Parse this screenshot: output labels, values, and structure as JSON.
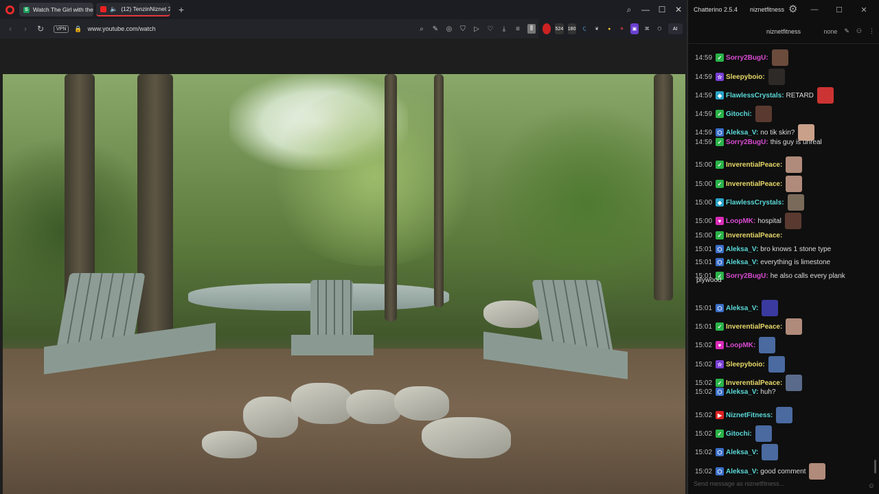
{
  "browser": {
    "tabs": [
      {
        "label": "Watch The Girl with the D",
        "favicon": "S",
        "active": true
      },
      {
        "label": "(12) TenzinNiznet 202",
        "favicon": "yt",
        "active": false
      }
    ],
    "new_tab": "+",
    "controls": {
      "search": "⌕",
      "minimize": "—",
      "maximize": "☐",
      "close": "✕"
    },
    "address": {
      "vpn": "VPN",
      "url": "www.youtube.com/watch"
    },
    "ext_labels": {
      "count_a": "524",
      "count_b": "180",
      "ai": "AI"
    }
  },
  "chat": {
    "app_title": "Chatterino 2.5.4",
    "user": "niznetfitness",
    "channel": "niznetfitness",
    "mode": "none",
    "input_placeholder": "Send message as niznetfitness...",
    "messages": [
      {
        "time": "14:59",
        "badge": "green",
        "name": "Sorry2BugU:",
        "color": "#d94bd2",
        "text": "",
        "emote": "#6b4b3b"
      },
      {
        "time": "14:59",
        "badge": "purple",
        "name": "Sleepyboio:",
        "color": "#e8d96a",
        "text": "",
        "emote": "#2e2a28"
      },
      {
        "time": "14:59",
        "badge": "cyan",
        "name": "FlawlessCrystals:",
        "color": "#5ad8d8",
        "text": "RETARD",
        "emote": "#c33"
      },
      {
        "time": "14:59",
        "badge": "green",
        "name": "Gitochi:",
        "color": "#5ad8d8",
        "text": "",
        "emote": "#5a3a30"
      },
      {
        "time": "14:59",
        "badge": "blue",
        "name": "Aleksa_V:",
        "color": "#5ad8d8",
        "text": "no tik skin?",
        "emote": "#c9a08a"
      },
      {
        "time": "14:59",
        "badge": "green",
        "name": "Sorry2BugU:",
        "color": "#d94bd2",
        "text": "this guy is unreal",
        "emote": ""
      },
      {
        "time": "15:00",
        "badge": "green",
        "name": "InverentialPeace:",
        "color": "#e8d96a",
        "text": "",
        "emote": "#b08a7a"
      },
      {
        "time": "15:00",
        "badge": "green",
        "name": "InverentialPeace:",
        "color": "#e8d96a",
        "text": "",
        "emote": "#b08a7a"
      },
      {
        "time": "15:00",
        "badge": "cyan",
        "name": "FlawlessCrystals:",
        "color": "#5ad8d8",
        "text": "",
        "emote": "#7a6a5a"
      },
      {
        "time": "15:00",
        "badge": "pink",
        "name": "LoopMK:",
        "color": "#d94bd2",
        "text": "hospital",
        "emote": "#5a3a30"
      },
      {
        "time": "15:00",
        "badge": "green",
        "name": "InverentialPeace:",
        "color": "#e8d96a",
        "text": "",
        "emote": ""
      },
      {
        "time": "15:01",
        "badge": "blue",
        "name": "Aleksa_V:",
        "color": "#5ad8d8",
        "text": "bro knows 1 stone type",
        "emote": ""
      },
      {
        "time": "15:01",
        "badge": "blue",
        "name": "Aleksa_V:",
        "color": "#5ad8d8",
        "text": "everything is limestone",
        "emote": ""
      },
      {
        "time": "15:01",
        "badge": "green",
        "name": "Sorry2BugU:",
        "color": "#d94bd2",
        "text": "he also calls every plank",
        "emote": ""
      },
      {
        "time": "15:01",
        "badge": "blue",
        "name": "Aleksa_V:",
        "color": "#5ad8d8",
        "text": "",
        "emote": "#3a3aa0"
      },
      {
        "time": "15:01",
        "badge": "green",
        "name": "InverentialPeace:",
        "color": "#e8d96a",
        "text": "",
        "emote": "#b08a7a"
      },
      {
        "time": "15:02",
        "badge": "pink",
        "name": "LoopMK:",
        "color": "#d94bd2",
        "text": "",
        "emote": "#4a6aa0"
      },
      {
        "time": "15:02",
        "badge": "purple",
        "name": "Sleepyboio:",
        "color": "#e8d96a",
        "text": "",
        "emote": "#4a6aa0"
      },
      {
        "time": "15:02",
        "badge": "green",
        "name": "InverentialPeace:",
        "color": "#e8d96a",
        "text": "",
        "emote": "#5a6a8a"
      },
      {
        "time": "15:02",
        "badge": "blue",
        "name": "Aleksa_V:",
        "color": "#5ad8d8",
        "text": "huh?",
        "emote": ""
      },
      {
        "time": "15:02",
        "badge": "red",
        "name": "NiznetFitness:",
        "color": "#5ad8d8",
        "text": "",
        "emote": "#4a6aa0"
      },
      {
        "time": "15:02",
        "badge": "green",
        "name": "Gitochi:",
        "color": "#5ad8d8",
        "text": "",
        "emote": "#4a6aa0"
      },
      {
        "time": "15:02",
        "badge": "blue",
        "name": "Aleksa_V:",
        "color": "#5ad8d8",
        "text": "",
        "emote": "#4a6aa0"
      },
      {
        "time": "15:02",
        "badge": "blue",
        "name": "Aleksa_V:",
        "color": "#5ad8d8",
        "text": "good comment",
        "emote": "#b08a7a"
      }
    ],
    "wrap_text": "plywood"
  }
}
